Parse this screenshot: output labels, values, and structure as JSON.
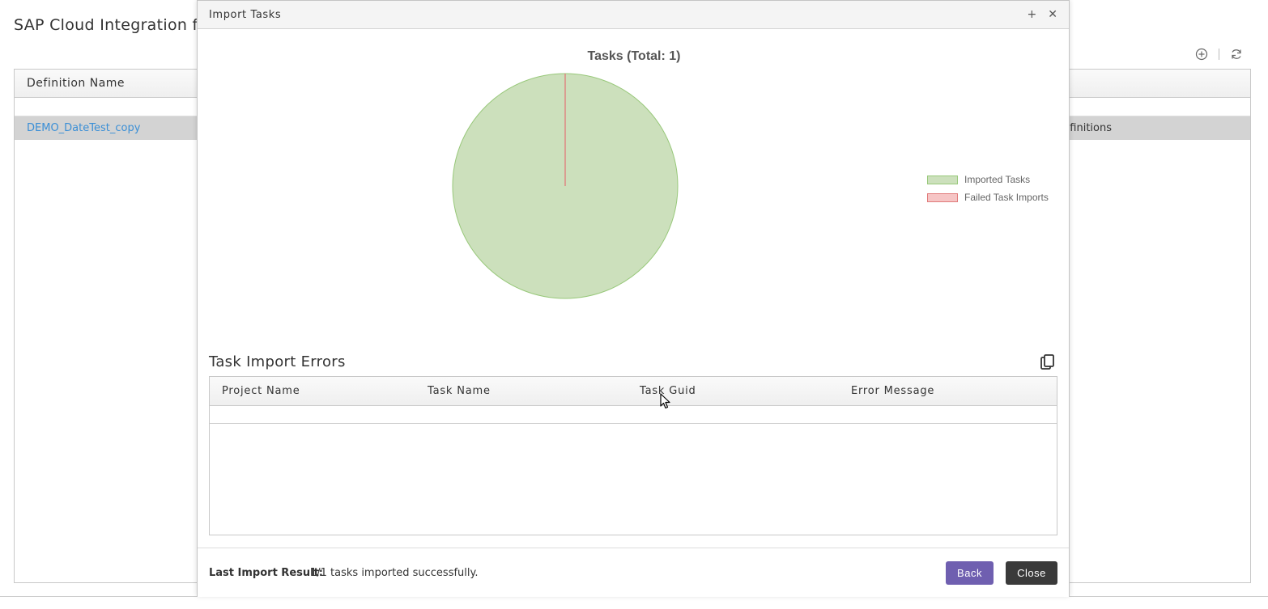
{
  "background": {
    "page_title": "SAP Cloud Integration fo",
    "toolbar": {
      "add_icon": "plus-circle-icon",
      "refresh_icon": "refresh-icon"
    },
    "table": {
      "column_header": "Definition Name",
      "row": {
        "name": "DEMO_DateTest_copy",
        "description": "s task definitions"
      }
    }
  },
  "modal": {
    "title": "Import Tasks",
    "maximize_label": "+",
    "close_label": "✕",
    "chart_data": {
      "type": "pie",
      "title": "Tasks (Total: 1)",
      "slices": [
        {
          "label": "Imported Tasks",
          "value": 1,
          "color": "#cce0bc",
          "border": "#98c87a"
        },
        {
          "label": "Failed Task Imports",
          "value": 0,
          "color": "#f6c5c5",
          "border": "#e07a7a"
        }
      ],
      "legend_position": "right"
    },
    "errors": {
      "title": "Task Import Errors",
      "copy_icon": "copy-icon",
      "columns": [
        "Project Name",
        "Task Name",
        "Task Guid",
        "Error Message"
      ],
      "rows": []
    },
    "footer": {
      "result_label": "Last Import Result:",
      "result_value": "1/1 tasks imported successfully.",
      "back_label": "Back",
      "close_label": "Close"
    }
  },
  "colors": {
    "accent_purple": "#6f5fb0",
    "dark_button": "#3a3a3a",
    "link": "#3b8fd6"
  }
}
